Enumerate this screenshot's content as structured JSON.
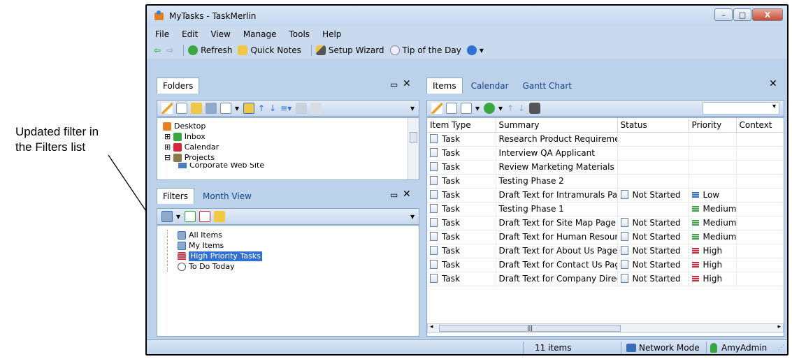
{
  "callout": {
    "line1": "Updated filter in",
    "line2": "the Filters list"
  },
  "window": {
    "title": "MyTasks - TaskMerlin",
    "min": "–",
    "max": "□",
    "close": "X"
  },
  "menu": [
    "File",
    "Edit",
    "View",
    "Manage",
    "Tools",
    "Help"
  ],
  "toolbar": {
    "refresh": "Refresh",
    "quick_notes": "Quick Notes",
    "setup_wizard": "Setup Wizard",
    "tip": "Tip of the Day"
  },
  "folders": {
    "tab": "Folders",
    "items": [
      "Desktop",
      "Inbox",
      "Calendar",
      "Projects",
      "Corporate Web Site"
    ]
  },
  "filters": {
    "tabs": [
      "Filters",
      "Month View"
    ],
    "items": [
      "All Items",
      "My Items",
      "High Priority Tasks",
      "To Do Today"
    ]
  },
  "items_pane": {
    "tabs": [
      "Items",
      "Calendar",
      "Gantt Chart"
    ],
    "columns": [
      "Item Type",
      "Summary",
      "Status",
      "Priority",
      "Context"
    ],
    "rows": [
      {
        "type": "Task",
        "summary": "Research Product Requireme",
        "status": "",
        "priority": ""
      },
      {
        "type": "Task",
        "summary": "Interview QA Applicant",
        "status": "",
        "priority": ""
      },
      {
        "type": "Task",
        "summary": "Review Marketing Materials",
        "status": "",
        "priority": ""
      },
      {
        "type": "Task",
        "summary": "Testing Phase 2",
        "status": "",
        "priority": ""
      },
      {
        "type": "Task",
        "summary": "Draft Text for Intramurals Pa",
        "status": "Not Started",
        "priority": "Low"
      },
      {
        "type": "Task",
        "summary": "Testing Phase 1",
        "status": "",
        "priority": "Medium"
      },
      {
        "type": "Task",
        "summary": "Draft Text for Site Map Page",
        "status": "Not Started",
        "priority": "Medium"
      },
      {
        "type": "Task",
        "summary": "Draft Text for Human Resour",
        "status": "Not Started",
        "priority": "Medium"
      },
      {
        "type": "Task",
        "summary": "Draft Text for About Us Page",
        "status": "Not Started",
        "priority": "High"
      },
      {
        "type": "Task",
        "summary": "Draft Text for Contact Us Pag",
        "status": "Not Started",
        "priority": "High"
      },
      {
        "type": "Task",
        "summary": "Draft Text for Company Direc",
        "status": "Not Started",
        "priority": "High"
      }
    ]
  },
  "statusbar": {
    "count": "11 items",
    "mode": "Network Mode",
    "user": "AmyAdmin"
  },
  "colors": {
    "low": "#2e6fd6",
    "medium": "#3aa641",
    "high": "#d4283a",
    "selection": "#3170d1"
  }
}
